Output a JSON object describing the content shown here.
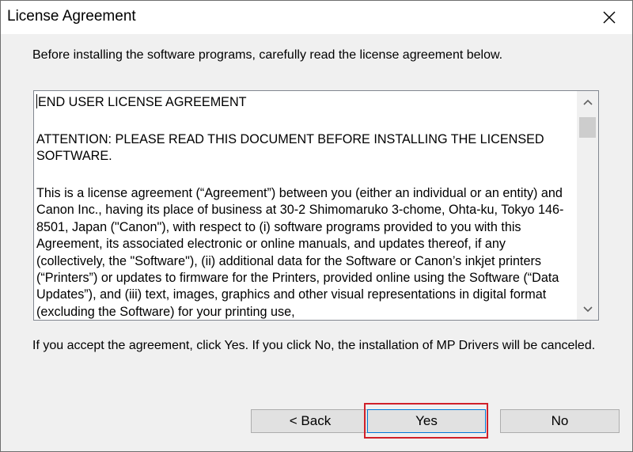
{
  "window": {
    "title": "License Agreement"
  },
  "instruction": "Before installing the software programs, carefully read the license agreement below.",
  "license": {
    "paragraphs": [
      "END USER LICENSE AGREEMENT",
      "ATTENTION: PLEASE READ THIS DOCUMENT BEFORE INSTALLING THE LICENSED SOFTWARE.",
      "This is a license agreement (“Agreement”) between you (either an individual or an entity) and Canon Inc., having its place of business at 30-2 Shimomaruko 3-chome, Ohta-ku, Tokyo 146-8501, Japan (\"Canon\"), with respect to (i) software programs provided to you with this Agreement, its associated electronic or online manuals, and updates thereof, if any (collectively, the \"Software\"), (ii) additional data for the Software or Canon’s inkjet printers (“Printers”) or updates to firmware for the Printers, provided online using the Software (“Data Updates”), and (iii) text, images, graphics and other visual representations in digital format (excluding the Software) for your printing use,"
    ]
  },
  "accept_note": "If you accept the agreement, click Yes. If you click No, the installation of MP Drivers will be canceled.",
  "buttons": {
    "back": "< Back",
    "yes": "Yes",
    "no": "No"
  },
  "colors": {
    "highlight": "#d0202a",
    "focus_border": "#0078d7"
  },
  "icons": {
    "close": "close-icon",
    "scroll_up": "chevron-up-icon",
    "scroll_down": "chevron-down-icon"
  }
}
